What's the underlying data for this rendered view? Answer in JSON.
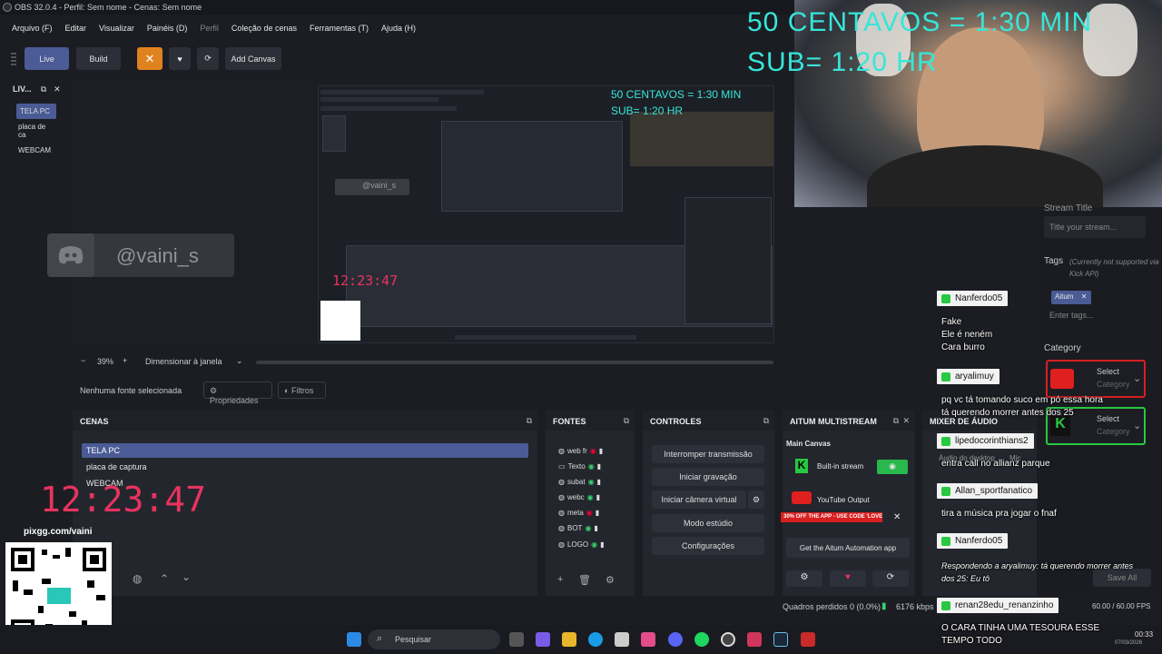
{
  "window": {
    "title": "OBS 32.0.4 - Perfil: Sem nome - Cenas: Sem nome"
  },
  "menu": [
    "Arquivo (F)",
    "Editar",
    "Visualizar",
    "Painéis (D)",
    "Perfil",
    "Coleção de cenas",
    "Ferramentas (T)",
    "Ajuda (H)"
  ],
  "toolbar": {
    "live": "Live",
    "build": "Build",
    "add_canvas": "Add Canvas"
  },
  "left_dock": {
    "title": "LIV...",
    "items": [
      "TELA PC",
      "placa de ca",
      "WEBCAM"
    ]
  },
  "preview": {
    "discord_user": "@vaini_s",
    "nested_clock": "12:23:47",
    "nested_user": "@vaini_s",
    "nested_overlay_1": "50 CENTAVOS = 1:30 MIN",
    "nested_overlay_2": "SUB= 1:20 HR",
    "clock": "12:23:47",
    "pixgg": "pixgg.com/vaini"
  },
  "zoom": {
    "minus": "−",
    "value": "39%",
    "plus": "+",
    "fit": "Dimensionar à janela"
  },
  "sourcebar": {
    "none": "Nenhuma fonte selecionada",
    "props": "Propriedades",
    "filters": "Filtros"
  },
  "scenes_dock": {
    "title": "CENAS",
    "items": [
      "TELA PC",
      "placa de captura",
      "WEBCAM"
    ]
  },
  "sources_dock": {
    "title": "FONTES",
    "items": [
      "web fr",
      "Texto",
      "subat",
      "webc",
      "meta",
      "BOT",
      "LOGO"
    ]
  },
  "controls_dock": {
    "title": "CONTROLES",
    "buttons": [
      "Interromper transmissão",
      "Iniciar gravação",
      "Iniciar câmera virtual",
      "Modo estúdio",
      "Configurações"
    ]
  },
  "aitum_dock": {
    "title": "AITUM MULTISTREAM",
    "main_canvas": "Main Canvas",
    "built_in": "Built-in stream",
    "youtube": "YouTube Output",
    "promo": "30% OFF THE APP - USE CODE 'LOVE'",
    "get_app": "Get the Aitum Automation app"
  },
  "mixer_dock": {
    "title": "MIXER DE ÁUDIO",
    "audio": "Áudio do desktop",
    "mic": "Mic"
  },
  "overlay": {
    "line1": "50 CENTAVOS = 1:30 MIN",
    "line2": "SUB= 1:20 HR"
  },
  "stream_panel": {
    "stream_title_label": "Stream Title",
    "stream_title_placeholder": "Title your stream...",
    "tags_label": "Tags",
    "tags_note": "(Currently not supported via Kick API)",
    "tag": "Aitum",
    "tags_placeholder": "Enter tags...",
    "category_label": "Category",
    "select1": "Select",
    "category1": "Category",
    "select2": "Select",
    "category2": "Category",
    "save_all": "Save All"
  },
  "chat": [
    {
      "user": "Nanferdo05",
      "msg": "Fake\nEle é neném\nCara burro"
    },
    {
      "user": "aryalimuy",
      "msg": "pq vc tá tomando suco em pó essa hora\ntá querendo morrer antes dos 25"
    },
    {
      "user": "lipedocorinthians2",
      "msg": "entra call no allianz parque"
    },
    {
      "user": "Allan_sportfanatico",
      "msg": "tira a música pra jogar o fnaf"
    },
    {
      "user": "Nanferdo05",
      "msg": "Respondendo a aryalimuy: tá querendo morrer antes dos 25: Eu tô"
    },
    {
      "user": "renan28edu_renanzinho",
      "msg": "O CARA TINHA UMA TESOURA ESSE\nTEMPO TODO"
    }
  ],
  "statusbar": {
    "dropped": "Quadros perdidos 0 (0.0%)",
    "kbps": "6176 kbps",
    "fps": "60.00 / 60.00 FPS"
  },
  "taskbar": {
    "search": "Pesquisar",
    "time": "00:33",
    "date": "07/03/2026"
  },
  "colors": {
    "accent": "#4a5b95",
    "orange": "#e0821e",
    "clock_pink": "#e8335f",
    "overlay_cyan": "#36e6d9",
    "chat_green": "#28c840"
  }
}
